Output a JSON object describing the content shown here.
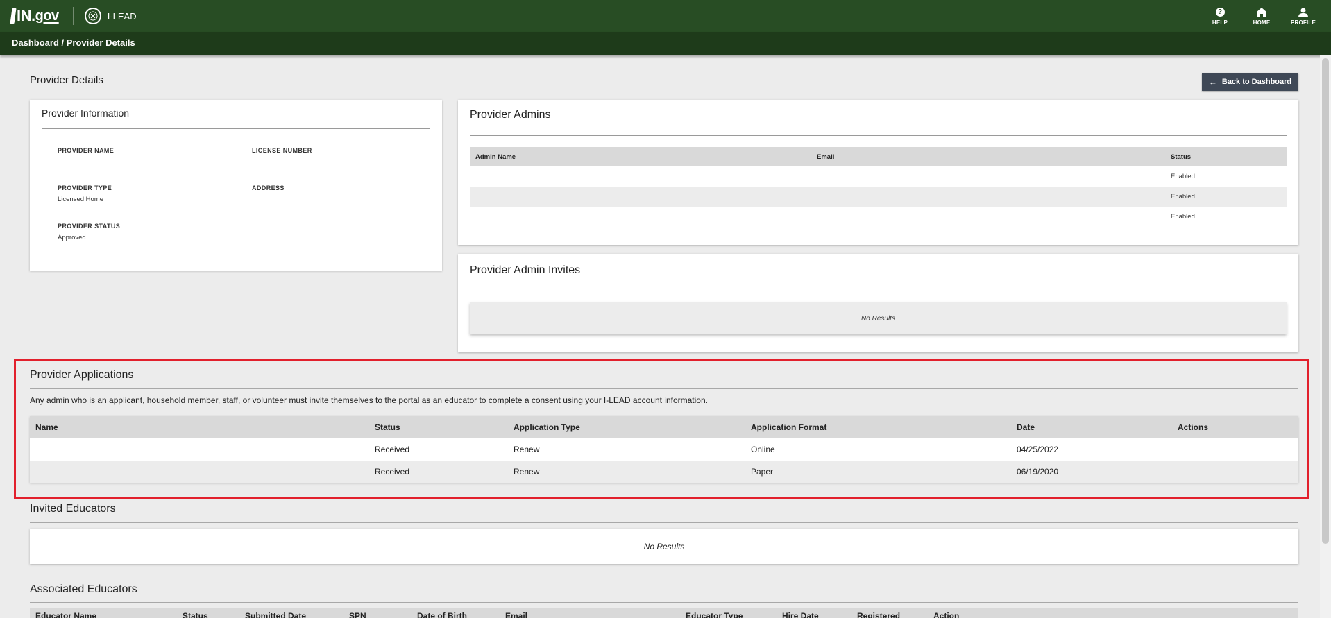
{
  "header": {
    "brand_logo": "IN.gov",
    "brand_logo_main": "IN.",
    "brand_logo_suffix": "gov",
    "app_name": "I-LEAD",
    "nav": [
      {
        "label": "HELP",
        "icon": "help-icon"
      },
      {
        "label": "HOME",
        "icon": "home-icon"
      },
      {
        "label": "PROFILE",
        "icon": "profile-icon"
      }
    ]
  },
  "breadcrumb": {
    "root": "Dashboard",
    "separator": " / ",
    "current": "Provider Details"
  },
  "page": {
    "title": "Provider Details",
    "back_button": "Back to Dashboard"
  },
  "provider_info": {
    "title": "Provider Information",
    "fields": {
      "provider_name": {
        "label": "PROVIDER NAME",
        "value": ""
      },
      "license_number": {
        "label": "LICENSE NUMBER",
        "value": ""
      },
      "provider_type": {
        "label": "PROVIDER TYPE",
        "value": "Licensed Home"
      },
      "address": {
        "label": "ADDRESS",
        "value": ""
      },
      "provider_status": {
        "label": "PROVIDER STATUS",
        "value": "Approved"
      }
    }
  },
  "provider_admins": {
    "title": "Provider Admins",
    "columns": [
      "Admin Name",
      "Email",
      "Status"
    ],
    "rows": [
      {
        "name": "",
        "email": "",
        "status": "Enabled"
      },
      {
        "name": "",
        "email": "",
        "status": "Enabled"
      },
      {
        "name": "",
        "email": "",
        "status": "Enabled"
      }
    ]
  },
  "provider_admin_invites": {
    "title": "Provider Admin Invites",
    "empty_text": "No Results"
  },
  "provider_applications": {
    "title": "Provider Applications",
    "note": "Any admin who is an applicant, household member, staff, or volunteer must invite themselves to the portal as an educator to complete a consent using your I-LEAD account information.",
    "columns": [
      "Name",
      "Status",
      "Application Type",
      "Application Format",
      "Date",
      "Actions"
    ],
    "rows": [
      {
        "name": "",
        "status": "Received",
        "type": "Renew",
        "format": "Online",
        "date": "04/25/2022",
        "actions": ""
      },
      {
        "name": "",
        "status": "Received",
        "type": "Renew",
        "format": "Paper",
        "date": "06/19/2020",
        "actions": ""
      }
    ]
  },
  "invited_educators": {
    "title": "Invited Educators",
    "empty_text": "No Results"
  },
  "associated_educators": {
    "title": "Associated Educators",
    "columns": [
      "Educator Name",
      "Status",
      "Submitted Date",
      "SPN",
      "Date of Birth",
      "Email",
      "Educator Type",
      "Hire Date",
      "Registered",
      "Action"
    ]
  },
  "colors": {
    "header_green": "#284d24",
    "breadcrumb_green": "#1e3b1a",
    "back_button": "#3f4856",
    "highlight_red": "#e2202c"
  }
}
